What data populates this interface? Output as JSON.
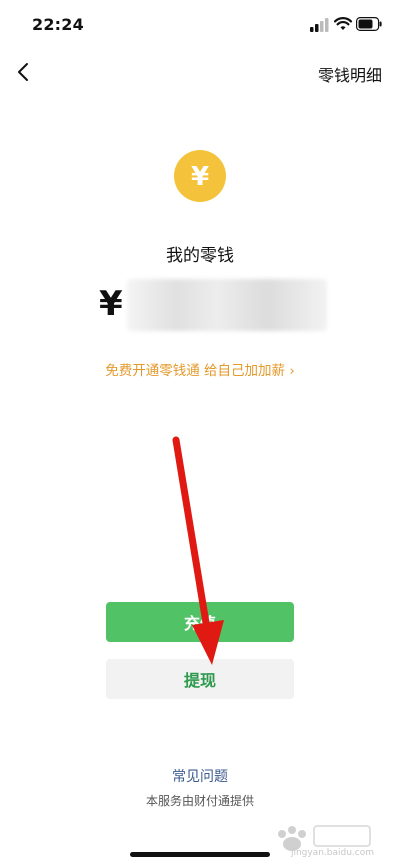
{
  "status_bar": {
    "time": "22:24"
  },
  "nav": {
    "right_link": "零钱明细"
  },
  "balance": {
    "title": "我的零钱",
    "currency_symbol": "¥",
    "coin_symbol": "¥"
  },
  "promo": {
    "text": "免费开通零钱通 给自己加加薪 ›"
  },
  "actions": {
    "recharge_label": "充值",
    "withdraw_label": "提现"
  },
  "footer": {
    "faq_label": "常见问题",
    "provider_text": "本服务由财付通提供"
  },
  "watermark": {
    "sub_text": "jingyan.baidu.com"
  },
  "colors": {
    "green": "#52C266",
    "withdraw_text": "#2D9A4C",
    "promo": "#E39A2B",
    "coin": "#F4C33B",
    "arrow": "#E01A12"
  }
}
